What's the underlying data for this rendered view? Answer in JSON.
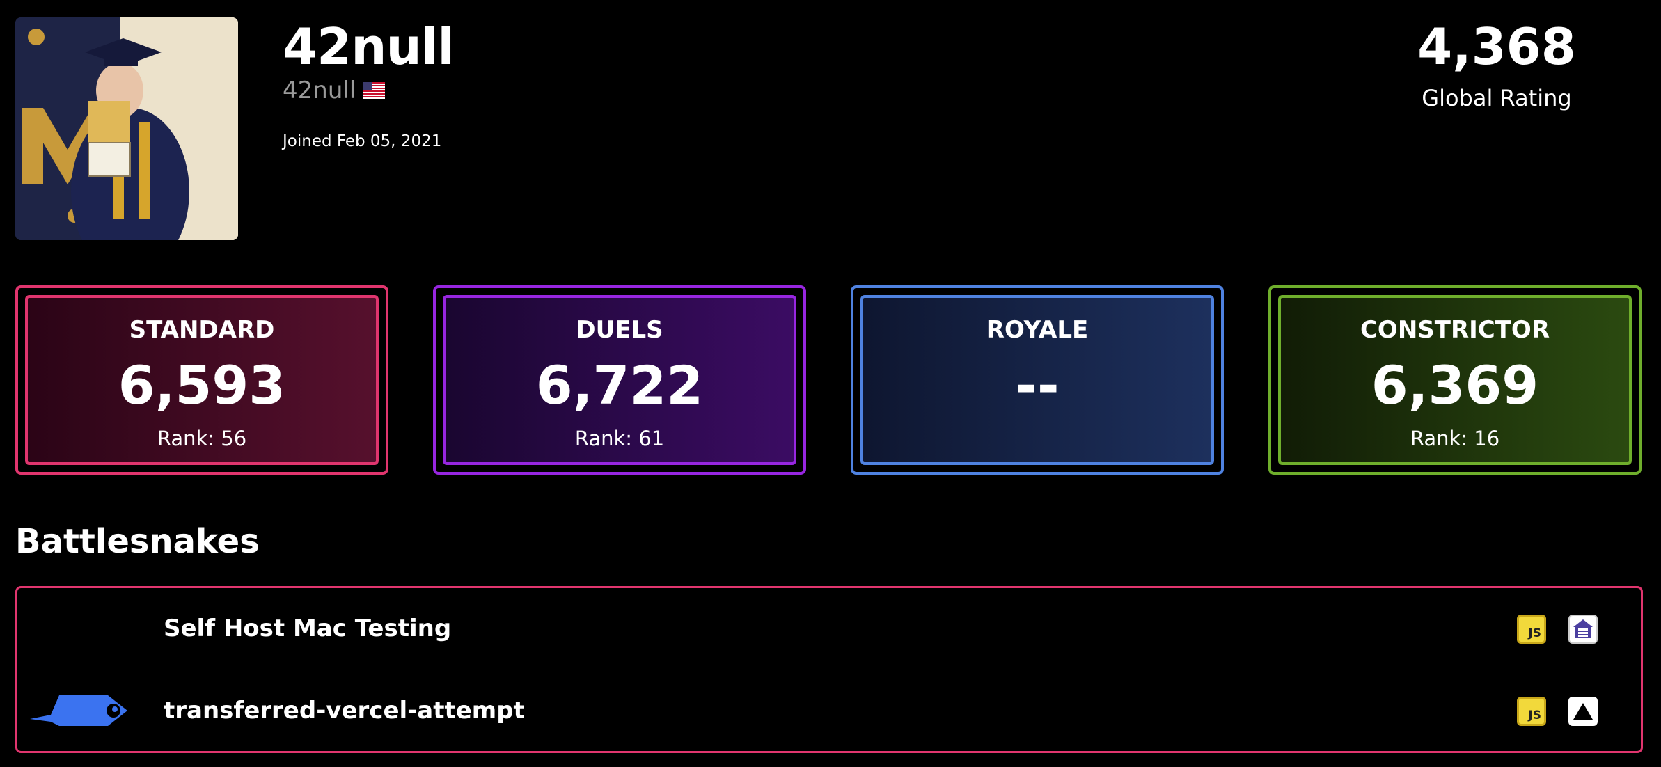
{
  "profile": {
    "name": "42null",
    "handle": "42null",
    "joined": "Joined Feb 05, 2021"
  },
  "global": {
    "value": "4,368",
    "label": "Global Rating"
  },
  "modes": [
    {
      "title": "STANDARD",
      "value": "6,593",
      "rank": "Rank: 56",
      "color": "#e0356e"
    },
    {
      "title": "DUELS",
      "value": "6,722",
      "rank": "Rank: 61",
      "color": "#9726e0"
    },
    {
      "title": "ROYALE",
      "value": "--",
      "rank": "",
      "color": "#4f82e0"
    },
    {
      "title": "CONSTRICTOR",
      "value": "6,369",
      "rank": "Rank: 16",
      "color": "#6fae2c"
    }
  ],
  "battlesnakes": {
    "title": "Battlesnakes",
    "items": [
      {
        "name": "Self Host Mac Testing",
        "language_badge": "JS",
        "platform_icon": "self-host-icon"
      },
      {
        "name": "transferred-vercel-attempt",
        "language_badge": "JS",
        "platform_icon": "vercel-icon"
      }
    ]
  }
}
